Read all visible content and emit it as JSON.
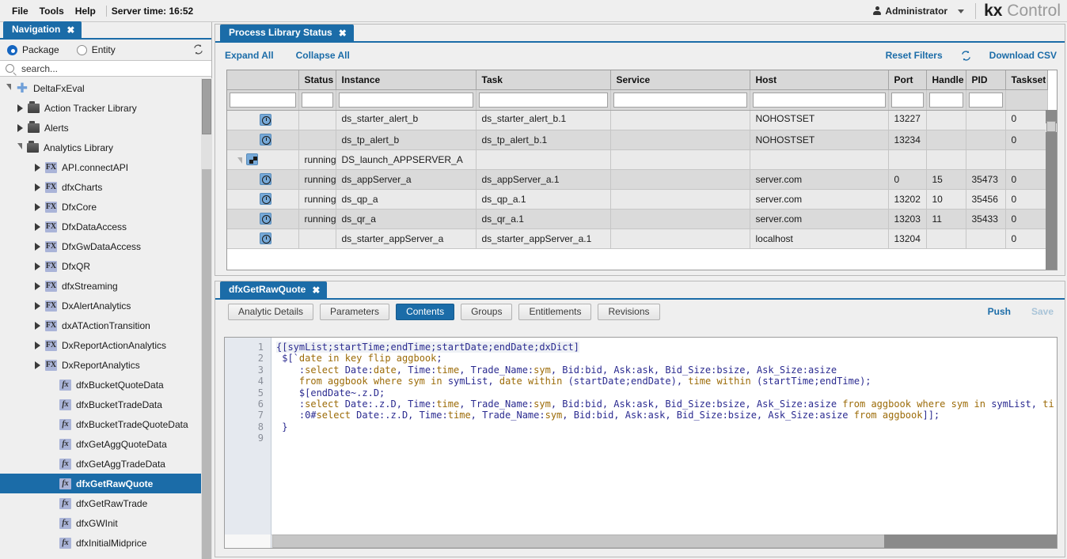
{
  "menubar": {
    "items": [
      "File",
      "Tools",
      "Help"
    ],
    "server_time_label": "Server time: 16:52",
    "user": "Administrator",
    "brand_bold": "kx",
    "brand_rest": " Control"
  },
  "navigation": {
    "tab_label": "Navigation",
    "tab_close": "✖",
    "radio_package": "Package",
    "radio_entity": "Entity",
    "selected_radio": "Package",
    "search_placeholder": "search...",
    "search_value": "",
    "tree": [
      {
        "label": "DeltaFxEval",
        "depth": 0,
        "state": "expanded",
        "icon": "plus-node-icon"
      },
      {
        "label": "Action Tracker Library",
        "depth": 1,
        "state": "collapsed",
        "icon": "folder-icon"
      },
      {
        "label": "Alerts",
        "depth": 1,
        "state": "collapsed",
        "icon": "folder-icon"
      },
      {
        "label": "Analytics Library",
        "depth": 1,
        "state": "expanded",
        "icon": "folder-icon"
      },
      {
        "label": "API.connectAPI",
        "depth": 2,
        "state": "collapsed",
        "icon": "fx-upper-icon"
      },
      {
        "label": "dfxCharts",
        "depth": 2,
        "state": "collapsed",
        "icon": "fx-upper-icon"
      },
      {
        "label": "DfxCore",
        "depth": 2,
        "state": "collapsed",
        "icon": "fx-upper-icon"
      },
      {
        "label": "DfxDataAccess",
        "depth": 2,
        "state": "collapsed",
        "icon": "fx-upper-icon"
      },
      {
        "label": "DfxGwDataAccess",
        "depth": 2,
        "state": "collapsed",
        "icon": "fx-upper-icon"
      },
      {
        "label": "DfxQR",
        "depth": 2,
        "state": "collapsed",
        "icon": "fx-upper-icon"
      },
      {
        "label": "dfxStreaming",
        "depth": 2,
        "state": "collapsed",
        "icon": "fx-upper-icon"
      },
      {
        "label": "DxAlertAnalytics",
        "depth": 2,
        "state": "collapsed",
        "icon": "fx-upper-icon"
      },
      {
        "label": "dxATActionTransition",
        "depth": 2,
        "state": "collapsed",
        "icon": "fx-upper-icon"
      },
      {
        "label": "DxReportActionAnalytics",
        "depth": 2,
        "state": "collapsed",
        "icon": "fx-upper-icon"
      },
      {
        "label": "DxReportAnalytics",
        "depth": 2,
        "state": "collapsed",
        "icon": "fx-upper-icon"
      },
      {
        "label": "dfxBucketQuoteData",
        "depth": 3,
        "state": "leaf",
        "icon": "fx-lower-icon"
      },
      {
        "label": "dfxBucketTradeData",
        "depth": 3,
        "state": "leaf",
        "icon": "fx-lower-icon"
      },
      {
        "label": "dfxBucketTradeQuoteData",
        "depth": 3,
        "state": "leaf",
        "icon": "fx-lower-icon"
      },
      {
        "label": "dfxGetAggQuoteData",
        "depth": 3,
        "state": "leaf",
        "icon": "fx-lower-icon"
      },
      {
        "label": "dfxGetAggTradeData",
        "depth": 3,
        "state": "leaf",
        "icon": "fx-lower-icon"
      },
      {
        "label": "dfxGetRawQuote",
        "depth": 3,
        "state": "leaf",
        "icon": "fx-lower-icon",
        "selected": true
      },
      {
        "label": "dfxGetRawTrade",
        "depth": 3,
        "state": "leaf",
        "icon": "fx-lower-icon"
      },
      {
        "label": "dfxGWInit",
        "depth": 3,
        "state": "leaf",
        "icon": "fx-lower-icon"
      },
      {
        "label": "dfxInitialMidprice",
        "depth": 3,
        "state": "leaf",
        "icon": "fx-lower-icon"
      }
    ]
  },
  "process_panel": {
    "tab_label": "Process Library Status",
    "tab_close": "✖",
    "expand_all": "Expand All",
    "collapse_all": "Collapse All",
    "reset_filters": "Reset Filters",
    "refresh_icon": "refresh-icon",
    "download_csv": "Download CSV",
    "columns": [
      "",
      "Status",
      "Instance",
      "Task",
      "Service",
      "Host",
      "Port",
      "Handle",
      "PID",
      "Taskset"
    ],
    "rows": [
      {
        "icon": "clock-icon",
        "indent": "child",
        "status": "",
        "instance": "ds_starter_alert_b",
        "task": "ds_starter_alert_b.1",
        "service": "",
        "host": "NOHOSTSET",
        "port": "13227",
        "handle": "",
        "pid": "",
        "taskset": "0",
        "clipped": true
      },
      {
        "icon": "clock-icon",
        "indent": "child",
        "status": "",
        "instance": "ds_tp_alert_b",
        "task": "ds_tp_alert_b.1",
        "service": "",
        "host": "NOHOSTSET",
        "port": "13234",
        "handle": "",
        "pid": "",
        "taskset": "0"
      },
      {
        "icon": "group-icon",
        "indent": "group",
        "status": "running",
        "instance": "DS_launch_APPSERVER_A",
        "task": "",
        "service": "",
        "host": "",
        "port": "",
        "handle": "",
        "pid": "",
        "taskset": ""
      },
      {
        "icon": "clock-icon",
        "indent": "child",
        "status": "running",
        "instance": "ds_appServer_a",
        "task": "ds_appServer_a.1",
        "service": "",
        "host": "server.com",
        "port": "0",
        "handle": "15",
        "pid": "35473",
        "taskset": "0"
      },
      {
        "icon": "clock-icon",
        "indent": "child",
        "status": "running",
        "instance": "ds_qp_a",
        "task": "ds_qp_a.1",
        "service": "",
        "host": "server.com",
        "port": "13202",
        "handle": "10",
        "pid": "35456",
        "taskset": "0"
      },
      {
        "icon": "clock-icon",
        "indent": "child",
        "status": "running",
        "instance": "ds_qr_a",
        "task": "ds_qr_a.1",
        "service": "",
        "host": "server.com",
        "port": "13203",
        "handle": "11",
        "pid": "35433",
        "taskset": "0"
      },
      {
        "icon": "clock-icon",
        "indent": "child",
        "status": "",
        "instance": "ds_starter_appServer_a",
        "task": "ds_starter_appServer_a.1",
        "service": "",
        "host": "localhost",
        "port": "13204",
        "handle": "",
        "pid": "",
        "taskset": "0"
      }
    ]
  },
  "editor_panel": {
    "tab_label": "dfxGetRawQuote",
    "tab_close": "✖",
    "subtabs": [
      {
        "label": "Analytic Details",
        "active": false
      },
      {
        "label": "Parameters",
        "active": false
      },
      {
        "label": "Contents",
        "active": true
      },
      {
        "label": "Groups",
        "active": false
      },
      {
        "label": "Entitlements",
        "active": false
      },
      {
        "label": "Revisions",
        "active": false
      }
    ],
    "push_label": "Push",
    "save_label": "Save",
    "save_disabled": true,
    "line_numbers": [
      "1",
      "2",
      "3",
      "4",
      "5",
      "6",
      "7",
      "8",
      "9"
    ],
    "code_lines": [
      "{[symList;startTime;endTime;startDate;endDate;dxDict]",
      " $[`date in key flip aggbook;",
      "    :select Date:date, Time:time, Trade_Name:sym, Bid:bid, Ask:ask, Bid_Size:bsize, Ask_Size:asize",
      "    from aggbook where sym in symList, date within (startDate;endDate), time within (startTime;endTime);",
      "    $[endDate~.z.D;",
      "    :select Date:.z.D, Time:time, Trade_Name:sym, Bid:bid, Ask:ask, Bid_Size:bsize, Ask_Size:asize from aggbook where sym in symList, time",
      "    :0#select Date:.z.D, Time:time, Trade_Name:sym, Bid:bid, Ask:ask, Bid_Size:bsize, Ask_Size:asize from aggbook]];",
      " }",
      ""
    ]
  },
  "colors": {
    "accent_blue": "#1b6ca8",
    "link_blue": "#1b6ca8",
    "selected_row": "#1b6ca8",
    "code_default": "#2b2b90",
    "code_keyword": "#9c6b08"
  }
}
